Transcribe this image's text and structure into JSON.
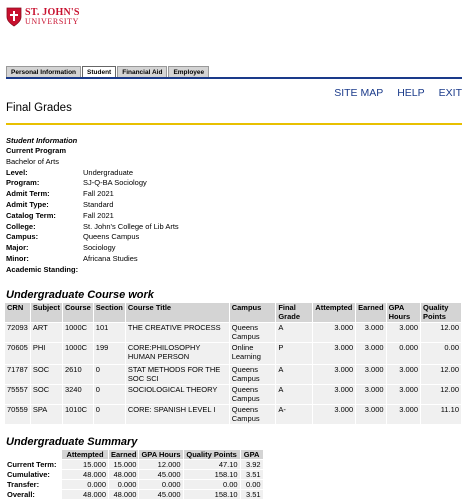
{
  "logo": {
    "line1": "ST. JOHN'S",
    "line2": "UNIVERSITY",
    "color": "#c8102e"
  },
  "tabs": [
    {
      "label": "Personal Information",
      "active": false
    },
    {
      "label": "Student",
      "active": true
    },
    {
      "label": "Financial Aid",
      "active": false
    },
    {
      "label": "Employee",
      "active": false
    }
  ],
  "toplinks": {
    "site_map": "SITE MAP",
    "help": "HELP",
    "exit": "EXIT"
  },
  "page_title": "Final Grades",
  "student_info": {
    "title": "Student Information",
    "rows": [
      {
        "label": "Current Program",
        "value": ""
      },
      {
        "label": "Bachelor of Arts",
        "value": ""
      },
      {
        "label": "Level:",
        "value": "Undergraduate"
      },
      {
        "label": "Program:",
        "value": "SJ-Q-BA Sociology"
      },
      {
        "label": "Admit Term:",
        "value": "Fall 2021"
      },
      {
        "label": "Admit Type:",
        "value": "Standard"
      },
      {
        "label": "Catalog Term:",
        "value": "Fall 2021"
      },
      {
        "label": "College:",
        "value": "St. John's College of Lib Arts"
      },
      {
        "label": "Campus:",
        "value": "Queens Campus"
      },
      {
        "label": "Major:",
        "value": "Sociology"
      },
      {
        "label": "Minor:",
        "value": "Africana Studies"
      },
      {
        "label": "Academic Standing:",
        "value": ""
      }
    ]
  },
  "course_work": {
    "title": "Undergraduate Course work",
    "headers": [
      "CRN",
      "Subject",
      "Course",
      "Section",
      "Course Title",
      "Campus",
      "Final Grade",
      "Attempted",
      "Earned",
      "GPA Hours",
      "Quality Points"
    ],
    "rows": [
      {
        "crn": "72093",
        "subject": "ART",
        "course": "1000C",
        "section": "101",
        "title": "THE CREATIVE PROCESS",
        "campus": "Queens Campus",
        "grade": "A",
        "attempted": "3.000",
        "earned": "3.000",
        "gpa_hours": "3.000",
        "quality_points": "12.00"
      },
      {
        "crn": "70605",
        "subject": "PHI",
        "course": "1000C",
        "section": "199",
        "title": "CORE:PHILOSOPHY HUMAN PERSON",
        "campus": "Online Learning",
        "grade": "P",
        "attempted": "3.000",
        "earned": "3.000",
        "gpa_hours": "0.000",
        "quality_points": "0.00"
      },
      {
        "crn": "71787",
        "subject": "SOC",
        "course": "2610",
        "section": "0",
        "title": "STAT METHODS FOR THE SOC SCI",
        "campus": "Queens Campus",
        "grade": "A",
        "attempted": "3.000",
        "earned": "3.000",
        "gpa_hours": "3.000",
        "quality_points": "12.00"
      },
      {
        "crn": "75557",
        "subject": "SOC",
        "course": "3240",
        "section": "0",
        "title": "SOCIOLOGICAL THEORY",
        "campus": "Queens Campus",
        "grade": "A",
        "attempted": "3.000",
        "earned": "3.000",
        "gpa_hours": "3.000",
        "quality_points": "12.00"
      },
      {
        "crn": "70559",
        "subject": "SPA",
        "course": "1010C",
        "section": "0",
        "title": "CORE: SPANISH LEVEL I",
        "campus": "Queens Campus",
        "grade": "A-",
        "attempted": "3.000",
        "earned": "3.000",
        "gpa_hours": "3.000",
        "quality_points": "11.10"
      }
    ]
  },
  "summary": {
    "title": "Undergraduate Summary",
    "headers": [
      "Attempted",
      "Earned",
      "GPA Hours",
      "Quality Points",
      "GPA"
    ],
    "rows": [
      {
        "label": "Current Term:",
        "attempted": "15.000",
        "earned": "15.000",
        "gpa_hours": "12.000",
        "quality_points": "47.10",
        "gpa": "3.92"
      },
      {
        "label": "Cumulative:",
        "attempted": "48.000",
        "earned": "48.000",
        "gpa_hours": "45.000",
        "quality_points": "158.10",
        "gpa": "3.51"
      },
      {
        "label": "Transfer:",
        "attempted": "0.000",
        "earned": "0.000",
        "gpa_hours": "0.000",
        "quality_points": "0.00",
        "gpa": "0.00"
      },
      {
        "label": "Overall:",
        "attempted": "48.000",
        "earned": "48.000",
        "gpa_hours": "45.000",
        "quality_points": "158.10",
        "gpa": "3.51"
      }
    ]
  }
}
